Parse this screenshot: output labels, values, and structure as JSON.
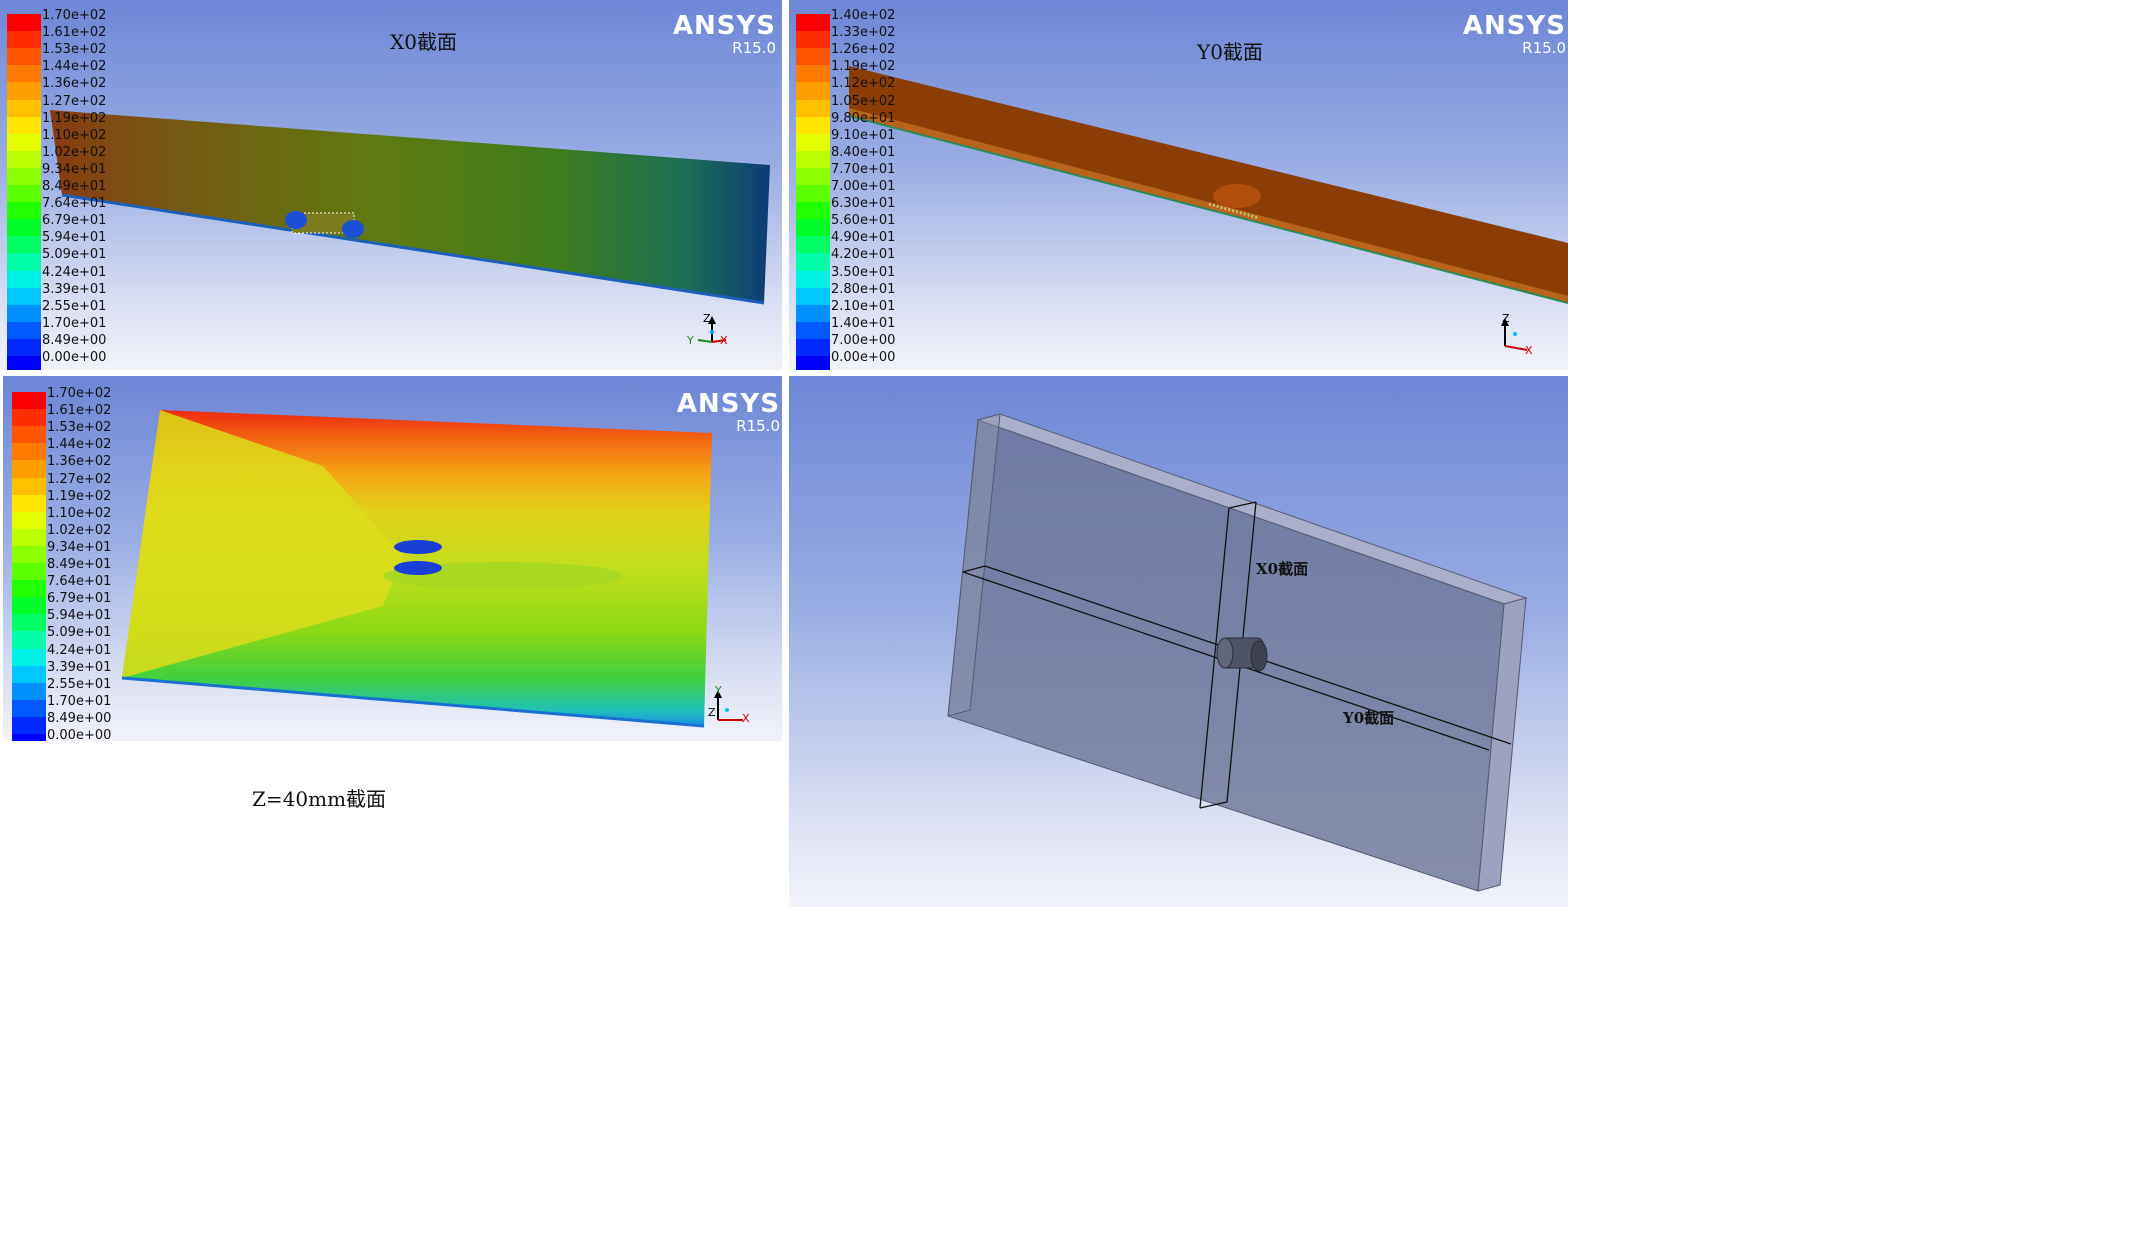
{
  "brand": {
    "name": "ANSYS",
    "version": "R15.0"
  },
  "panels": {
    "x0": {
      "caption": "X0截面",
      "legend": [
        "1.70e+02",
        "1.61e+02",
        "1.53e+02",
        "1.44e+02",
        "1.36e+02",
        "1.27e+02",
        "1.19e+02",
        "1.10e+02",
        "1.02e+02",
        "9.34e+01",
        "8.49e+01",
        "7.64e+01",
        "6.79e+01",
        "5.94e+01",
        "5.09e+01",
        "4.24e+01",
        "3.39e+01",
        "2.55e+01",
        "1.70e+01",
        "8.49e+00",
        "0.00e+00"
      ],
      "axes": {
        "up": "Z",
        "left": "Y",
        "right": "X"
      }
    },
    "y0": {
      "caption": "Y0截面",
      "legend": [
        "1.40e+02",
        "1.33e+02",
        "1.26e+02",
        "1.19e+02",
        "1.12e+02",
        "1.05e+02",
        "9.80e+01",
        "9.10e+01",
        "8.40e+01",
        "7.70e+01",
        "7.00e+01",
        "6.30e+01",
        "5.60e+01",
        "4.90e+01",
        "4.20e+01",
        "3.50e+01",
        "2.80e+01",
        "2.10e+01",
        "1.40e+01",
        "7.00e+00",
        "0.00e+00"
      ],
      "axes": {
        "up": "Z",
        "right": "X"
      }
    },
    "z40": {
      "caption": "Z=40mm截面",
      "legend": [
        "1.70e+02",
        "1.61e+02",
        "1.53e+02",
        "1.44e+02",
        "1.36e+02",
        "1.27e+02",
        "1.19e+02",
        "1.10e+02",
        "1.02e+02",
        "9.34e+01",
        "8.49e+01",
        "7.64e+01",
        "6.79e+01",
        "5.94e+01",
        "5.09e+01",
        "4.24e+01",
        "3.39e+01",
        "2.55e+01",
        "1.70e+01",
        "8.49e+00",
        "0.00e+00"
      ],
      "axes": {
        "up": "Y",
        "left": "Z",
        "right": "X"
      }
    },
    "geometry": {
      "x0_label": "X0截面",
      "y0_label": "Y0截面"
    }
  },
  "colormap": [
    "#ff0000",
    "#ff2d00",
    "#ff5400",
    "#ff7a00",
    "#ff9e00",
    "#ffc000",
    "#ffe500",
    "#e6ff00",
    "#bcff00",
    "#8cff00",
    "#5aff00",
    "#22ff00",
    "#00ff28",
    "#00ff64",
    "#00ffa8",
    "#00f2e6",
    "#00c8ff",
    "#0090ff",
    "#005aff",
    "#0028ff",
    "#0000ff"
  ]
}
